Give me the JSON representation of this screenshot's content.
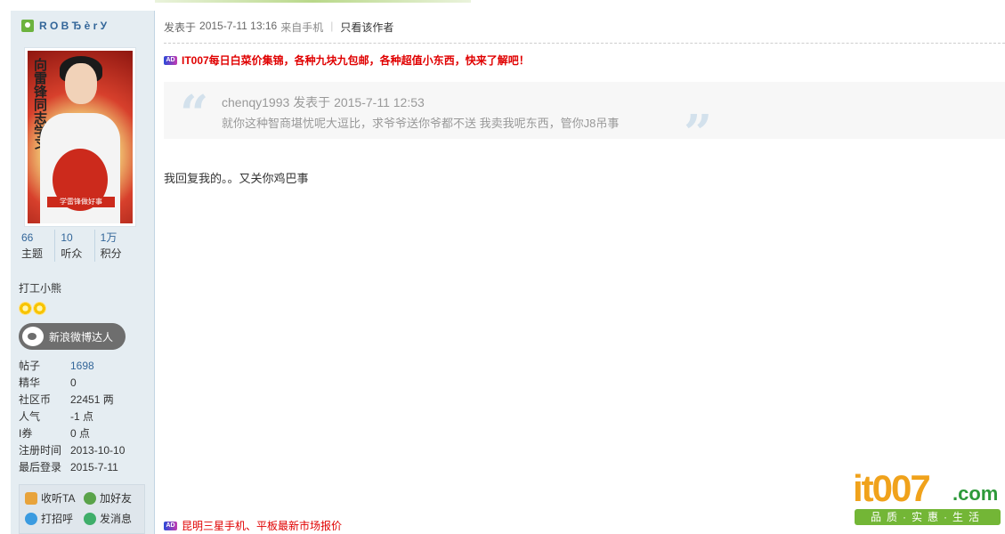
{
  "user": {
    "name": "R O B Ђ è r У",
    "avatar_caption": "学雷锋做好事",
    "avatar_calligraphy": "向雷锋同志学习",
    "stats": [
      {
        "value": "66",
        "label": "主题"
      },
      {
        "value": "10",
        "label": "听众"
      },
      {
        "value": "1万",
        "label": "积分"
      }
    ],
    "title": "打工小熊",
    "medal_label": "新浪微博达人",
    "info": [
      {
        "key": "帖子",
        "value": "1698",
        "link": true
      },
      {
        "key": "精华",
        "value": "0",
        "link": false
      },
      {
        "key": "社区币",
        "value": "22451 两",
        "link": false
      },
      {
        "key": "人气",
        "value": "-1 点",
        "link": false
      },
      {
        "key": "I券",
        "value": "0 点",
        "link": false
      },
      {
        "key": "注册时间",
        "value": "2013-10-10",
        "link": false
      },
      {
        "key": "最后登录",
        "value": "2015-7-11",
        "link": false
      }
    ],
    "actions": {
      "follow": "收听TA",
      "add_friend": "加好友",
      "greet": "打招呼",
      "message": "发消息"
    }
  },
  "post": {
    "posted_label": "发表于",
    "posted_time": "2015-7-11 13:16",
    "source": "来自手机",
    "only_author": "只看该作者",
    "ad_top": "IT007每日白菜价集锦，各种九块九包邮，各种超值小东西，快来了解吧！",
    "quote_author": "chenqy1993",
    "quote_posted": "发表于 2015-7-11 12:53",
    "quote_text": "就你这种智商堪忧呢大逗比，求爷爷送你爷都不送  我卖我呢东西，管你J8吊事",
    "reply_text": "我回复我的。。又关你鸡巴事",
    "ad_bottom": "昆明三星手机、平板最新市场报价",
    "ad_icon_text": "AD"
  },
  "logo": {
    "main": "it007",
    "domain": ".com",
    "slogan": "品质·实惠·生活"
  },
  "colors": {
    "link_blue": "#336699",
    "ad_red": "#e00000",
    "sidebar_bg": "#e5edf2",
    "logo_orange": "#f0a21b",
    "logo_green": "#73b636"
  }
}
